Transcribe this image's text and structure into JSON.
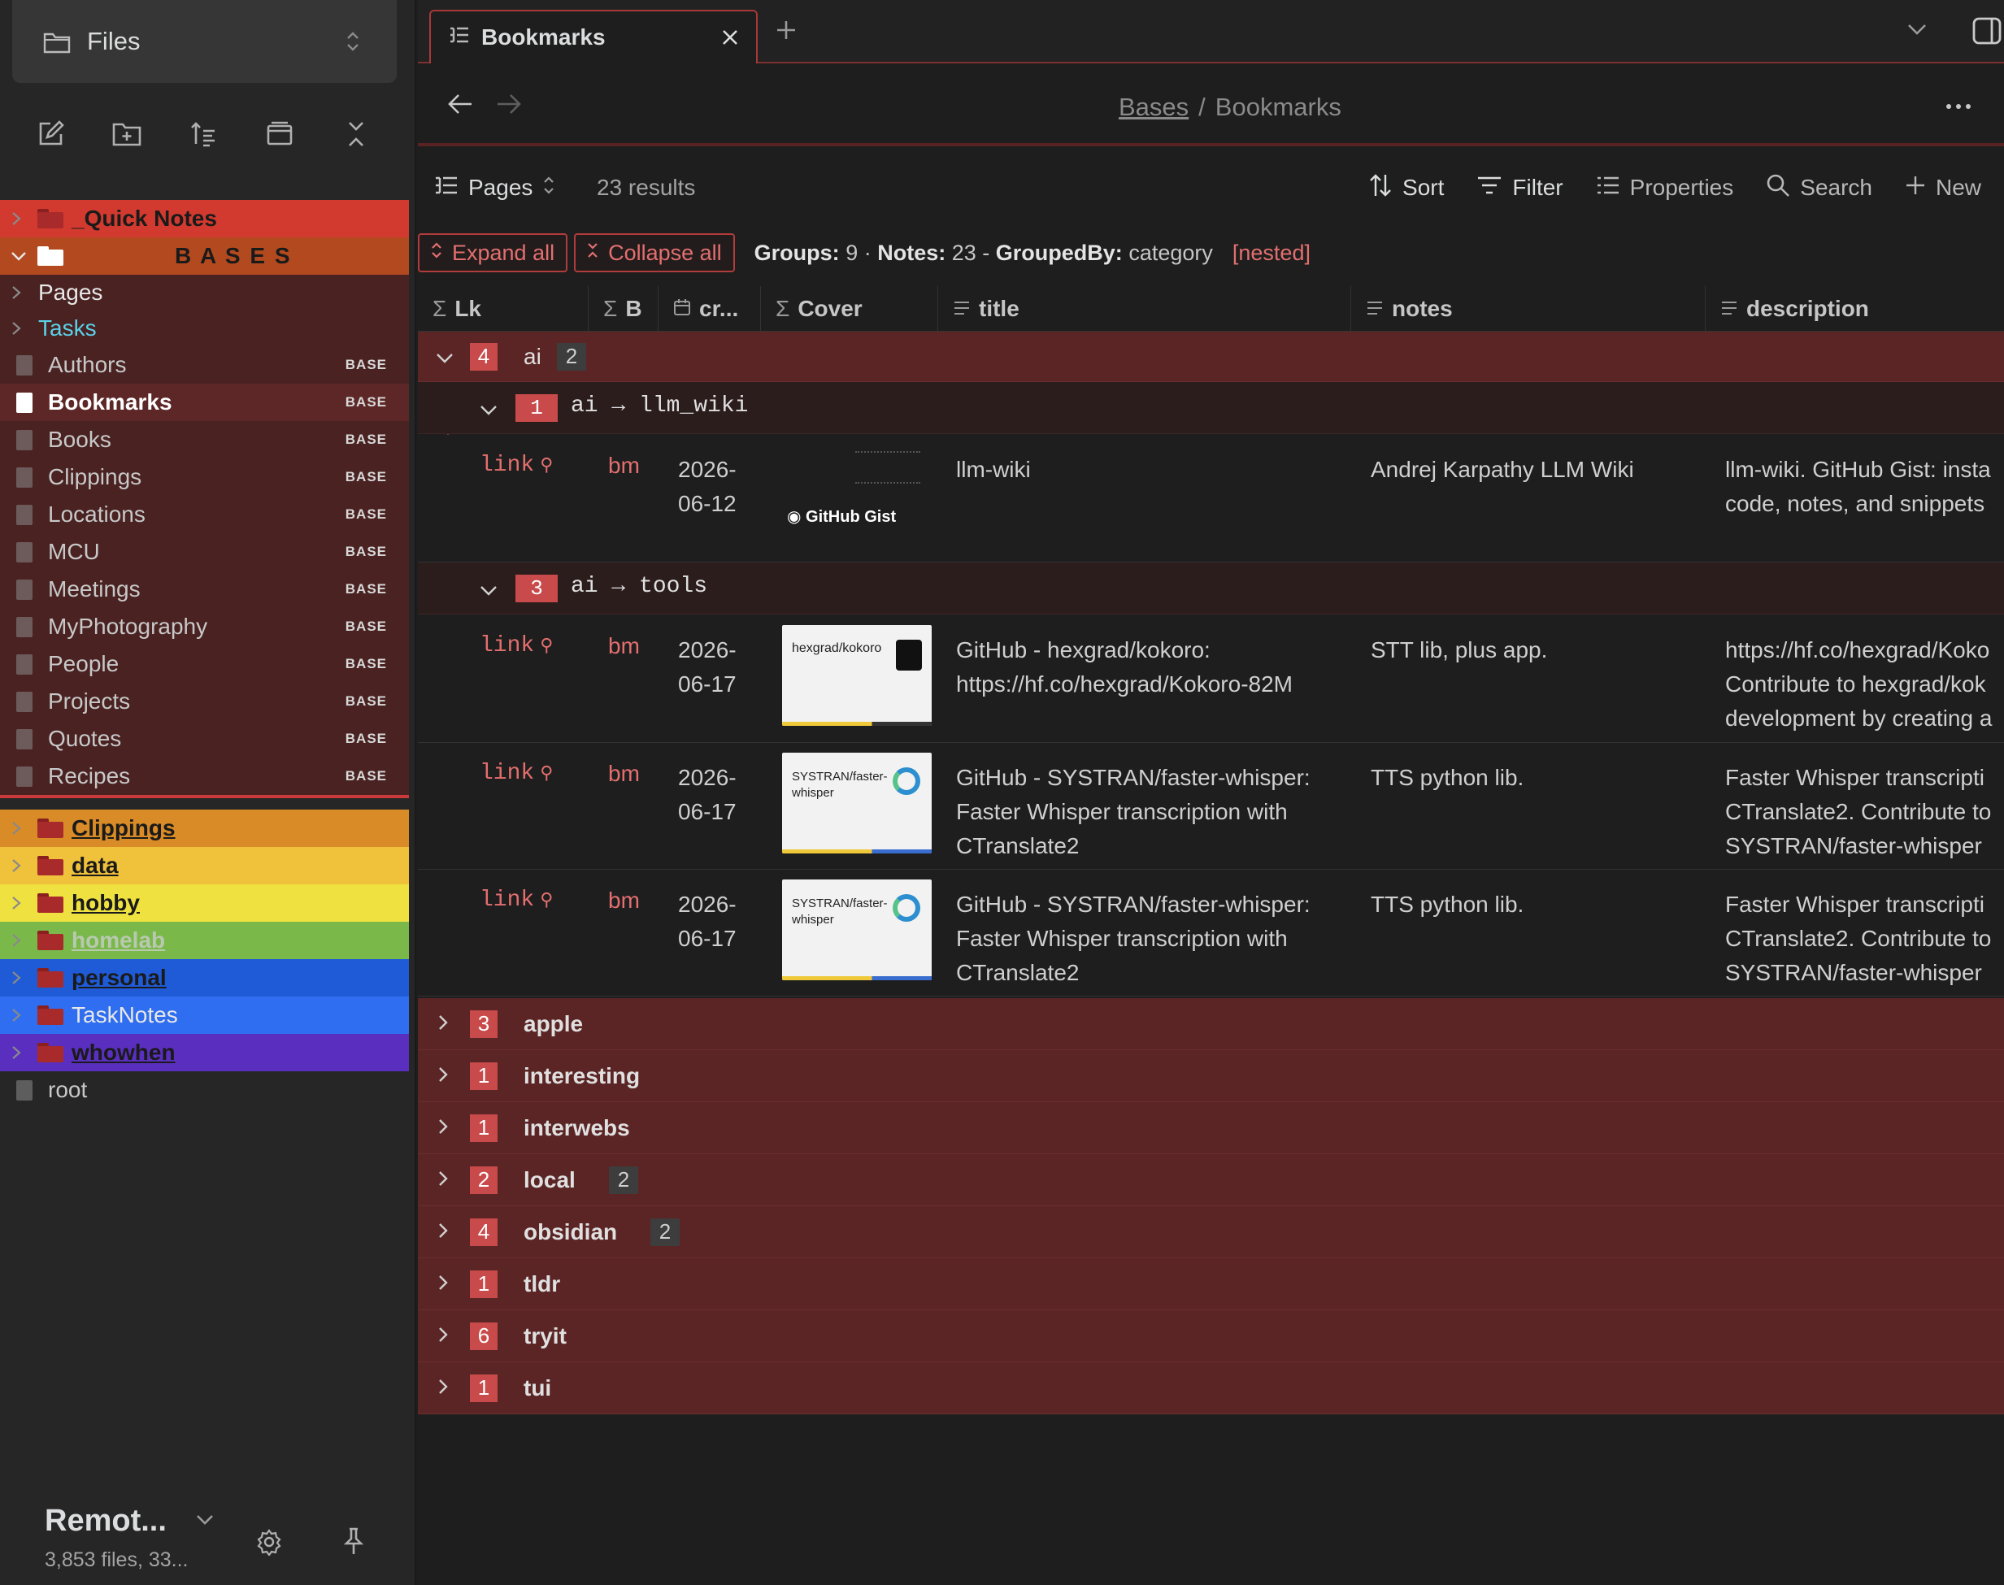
{
  "sidebar": {
    "switcher_label": "Files",
    "tree": [
      {
        "type": "folder",
        "label": "_Quick Notes",
        "bg": "#d23a2f",
        "color": "#1a1a1a"
      },
      {
        "type": "folder-open",
        "label": "B A S E S",
        "bg": "#b34a1f",
        "color": "#1a1a1a"
      },
      {
        "type": "sub",
        "label": "Pages",
        "color": "#e8e8e8"
      },
      {
        "type": "sub",
        "label": "Tasks",
        "color": "#5ad1e8"
      },
      {
        "type": "file",
        "label": "Authors",
        "tag": "BASE"
      },
      {
        "type": "file",
        "label": "Bookmarks",
        "tag": "BASE",
        "active": true
      },
      {
        "type": "file",
        "label": "Books",
        "tag": "BASE"
      },
      {
        "type": "file",
        "label": "Clippings",
        "tag": "BASE"
      },
      {
        "type": "file",
        "label": "Locations",
        "tag": "BASE"
      },
      {
        "type": "file",
        "label": "MCU",
        "tag": "BASE"
      },
      {
        "type": "file",
        "label": "Meetings",
        "tag": "BASE"
      },
      {
        "type": "file",
        "label": "MyPhotography",
        "tag": "BASE"
      },
      {
        "type": "file",
        "label": "People",
        "tag": "BASE"
      },
      {
        "type": "file",
        "label": "Projects",
        "tag": "BASE"
      },
      {
        "type": "file",
        "label": "Quotes",
        "tag": "BASE"
      },
      {
        "type": "file",
        "label": "Recipes",
        "tag": "BASE"
      }
    ],
    "folders": [
      {
        "label": "Clippings",
        "bg": "#d88b26",
        "color": "#1a1a1a"
      },
      {
        "label": "data",
        "bg": "#f0c13a",
        "color": "#1a1a1a"
      },
      {
        "label": "hobby",
        "bg": "#efe140",
        "color": "#1a1a1a"
      },
      {
        "label": "homelab",
        "bg": "#7ab84a",
        "color": "#b9c9b0"
      },
      {
        "label": "personal",
        "bg": "#1f5bd6",
        "color": "#1a1a1a"
      },
      {
        "label": "TaskNotes",
        "bg": "#2f6ef0",
        "color": "#e8e8e8"
      },
      {
        "label": "whowhen",
        "bg": "#5a2fc0",
        "color": "#1a1a1a"
      }
    ],
    "root_label": "root",
    "vault_name": "Remot...",
    "vault_stats": "3,853 files, 33..."
  },
  "tabs": {
    "active_label": "Bookmarks"
  },
  "nav": {
    "breadcrumb_parent": "Bases",
    "breadcrumb_sep": "/",
    "breadcrumb_current": "Bookmarks"
  },
  "basebar": {
    "view_label": "Pages",
    "results": "23 results",
    "sort": "Sort",
    "filter": "Filter",
    "properties": "Properties",
    "search": "Search",
    "new": "New"
  },
  "groupbar": {
    "expand_all": "Expand all",
    "collapse_all": "Collapse all",
    "groups_label": "Groups:",
    "groups_value": "9",
    "notes_label": "Notes:",
    "notes_value": "23",
    "groupedby_label": "GroupedBy:",
    "groupedby_value": "category",
    "nested": "[nested]"
  },
  "columns": [
    "Lk",
    "B",
    "cr...",
    "Cover",
    "title",
    "notes",
    "description"
  ],
  "ai_group": {
    "count": "4",
    "name": "ai",
    "sub": "2"
  },
  "subgroups": [
    {
      "count": "1",
      "name": "ai → llm_wiki"
    },
    {
      "count": "3",
      "name": "ai → tools"
    }
  ],
  "rows": [
    {
      "lk": "link",
      "b": "bm",
      "date1": "2026-",
      "date2": "06-12",
      "cover": "GitHub Gist",
      "title": "llm-wiki",
      "notes": "Andrej Karpathy LLM Wiki",
      "desc1": "llm-wiki. GitHub Gist: insta",
      "desc2": "code, notes, and snippets"
    },
    {
      "lk": "link",
      "b": "bm",
      "date1": "2026-",
      "date2": "06-17",
      "cover": "hexgrad/kokoro",
      "title1": "GitHub - hexgrad/kokoro:",
      "title2": "https://hf.co/hexgrad/Kokoro-82M",
      "notes": "STT lib, plus app.",
      "desc1": "https://hf.co/hexgrad/Koko",
      "desc2": "Contribute to hexgrad/kok",
      "desc3": "development by creating a"
    },
    {
      "lk": "link",
      "b": "bm",
      "date1": "2026-",
      "date2": "06-17",
      "cover": "SYSTRAN/faster-whisper",
      "title1": "GitHub - SYSTRAN/faster-whisper:",
      "title2": "Faster Whisper transcription with",
      "title3": "CTranslate2",
      "notes": "TTS python lib.",
      "desc1": "Faster Whisper transcripti",
      "desc2": "CTranslate2. Contribute to",
      "desc3": "SYSTRAN/faster-whisper"
    },
    {
      "lk": "link",
      "b": "bm",
      "date1": "2026-",
      "date2": "06-17",
      "cover": "SYSTRAN/faster-whisper",
      "title1": "GitHub - SYSTRAN/faster-whisper:",
      "title2": "Faster Whisper transcription with",
      "title3": "CTranslate2",
      "notes": "TTS python lib.",
      "desc1": "Faster Whisper transcripti",
      "desc2": "CTranslate2. Contribute to",
      "desc3": "SYSTRAN/faster-whisper"
    }
  ],
  "groups": [
    {
      "count": "3",
      "name": "apple"
    },
    {
      "count": "1",
      "name": "interesting"
    },
    {
      "count": "1",
      "name": "interwebs"
    },
    {
      "count": "2",
      "name": "local",
      "sub": "2"
    },
    {
      "count": "4",
      "name": "obsidian",
      "sub": "2"
    },
    {
      "count": "1",
      "name": "tldr"
    },
    {
      "count": "6",
      "name": "tryit"
    },
    {
      "count": "1",
      "name": "tui"
    }
  ],
  "colors": {
    "accent": "#c94a4a",
    "group_bg": "#5b2525",
    "link": "#e36f6f"
  }
}
